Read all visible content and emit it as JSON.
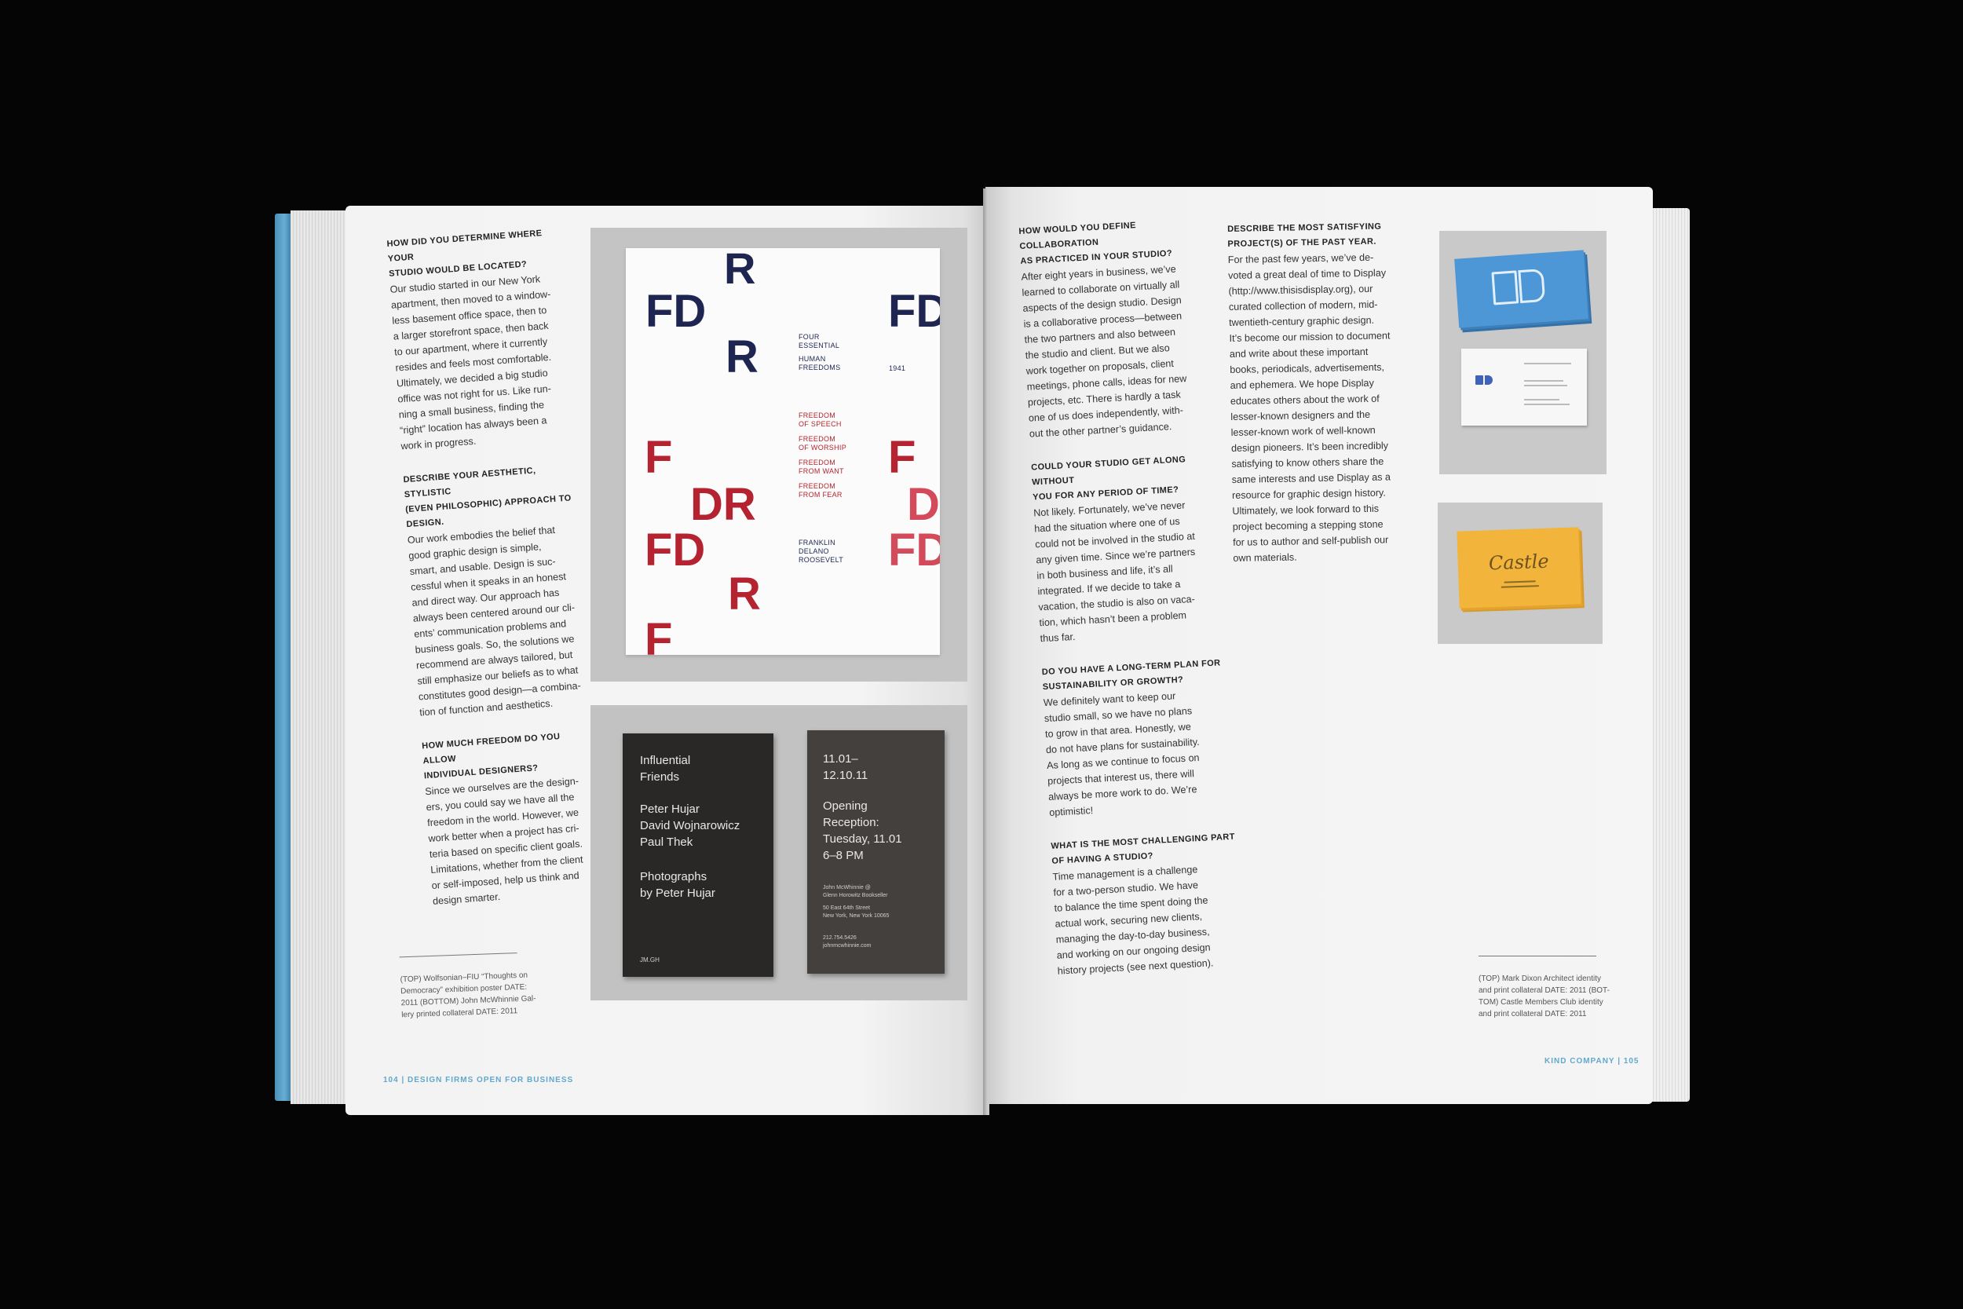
{
  "left_page": {
    "questions": [
      {
        "q": "How did you determine where your\nstudio would be located?",
        "a": "Our studio started in our New York\napartment, then moved to a window-\nless basement office space, then to\na larger storefront space, then back\nto our apartment, where it currently\nresides and feels most comfortable.\nUltimately, we decided a big studio\noffice was not right for us. Like run-\nning a small business, finding the\n“right” location has always been a\nwork in progress."
      },
      {
        "q": "Describe your aesthetic, stylistic\n(even philosophic) approach to\ndesign.",
        "a": "Our work embodies the belief that\ngood graphic design is simple,\nsmart, and usable. Design is suc-\ncessful when it speaks in an honest\nand direct way. Our approach has\nalways been centered around our cli-\nents’ communication problems and\nbusiness goals. So, the solutions we\nrecommend are always tailored, but\nstill emphasize our beliefs as to what\nconstitutes good design—a combina-\ntion of function and aesthetics."
      },
      {
        "q": "How much freedom do you allow\nindividual designers?",
        "a": "Since we ourselves are the design-\ners, you could say we have all the\nfreedom in the world. However, we\nwork better when a project has cri-\nteria based on specific client goals.\nLimitations, whether from the client\nor self-imposed, help us think and\ndesign smarter."
      }
    ],
    "caption": "(TOP) Wolfsonian–FIU “Thoughts on\nDemocracy” exhibition poster DATE:\n2011 (BOTTOM) John McWhinnie Gal-\nlery printed collateral DATE: 2011",
    "folio": "104  |  DESIGN FIRMS OPEN FOR BUSINESS"
  },
  "poster": {
    "letters": [
      "R",
      "FD",
      "FD",
      "R",
      "F",
      "F",
      "DR",
      "D",
      "FD",
      "FD",
      "R",
      "F"
    ],
    "text_four": "FOUR\nESSENTIAL",
    "text_human": "HUMAN\nFREEDOMS",
    "year": "1941",
    "freedom_speech": "FREEDOM\nOF SPEECH",
    "freedom_worship": "FREEDOM\nOF WORSHIP",
    "freedom_want": "FREEDOM\nFROM WANT",
    "freedom_fear": "FREEDOM\nFROM FEAR",
    "fdr_name": "FRANKLIN\nDELANO\nROOSEVELT"
  },
  "invites": {
    "card1_title": "Influential\nFriends",
    "card1_names": "Peter Hujar\nDavid Wojnarowicz\nPaul Thek",
    "card1_photos": "Photographs\nby Peter Hujar",
    "card1_logo": "JM.GH",
    "card2_dates": "11.01–\n12.10.11",
    "card2_opening": "Opening\nReception:\nTuesday, 11.01\n6–8 PM",
    "card2_gallery": "John McWhinnie @\nGlenn Horowitz Bookseller",
    "card2_address": "50 East 64th Street\nNew York, New York 10065",
    "card2_contact": "212.754.5426\njohnmcwhinnie.com"
  },
  "right_page": {
    "col1": [
      {
        "q": "How would you define collaboration\nas practiced in your studio?",
        "a": "After eight years in business, we’ve\nlearned to collaborate on virtually all\naspects of the design studio. Design\nis a collaborative process—between\nthe two partners and also between\nthe studio and client. But we also\nwork together on proposals, client\nmeetings, phone calls, ideas for new\nprojects, etc. There is hardly a task\none of us does independently, with-\nout the other partner’s guidance."
      },
      {
        "q": "Could your studio get along without\nyou for any period of time?",
        "a": "Not likely. Fortunately, we’ve never\nhad the situation where one of us\ncould not be involved in the studio at\nany given time. Since we’re partners\nin both business and life, it’s all\nintegrated. If we decide to take a\nvacation, the studio is also on vaca-\ntion, which hasn’t been a problem\nthus far."
      },
      {
        "q": "Do you have a long-term plan for\nsustainability or growth?",
        "a": "We definitely want to keep our\nstudio small, so we have no plans\nto grow in that area. Honestly, we\ndo not have plans for sustainability.\nAs long as we continue to focus on\nprojects that interest us, there will\nalways be more work to do. We’re\noptimistic!"
      },
      {
        "q": "What is the most challenging part\nof having a studio?",
        "a": "Time management is a challenge\nfor a two-person studio. We have\nto balance the time spent doing the\nactual work, securing new clients,\nmanaging the day-to-day business,\nand working on our ongoing design\nhistory projects (see next question)."
      }
    ],
    "col2": {
      "q": "Describe the most satisfying\nproject(s) of the past year.",
      "a": "For the past few years, we’ve de-\nvoted a great deal of time to Display\n(http://www.thisisdisplay.org), our\ncurated collection of modern, mid-\ntwentieth-century graphic design.\nIt’s become our mission to document\nand write about these important\nbooks, periodicals, advertisements,\nand ephemera. We hope Display\neducates others about the work of\nlesser-known designers and the\nlesser-known work of well-known\ndesign pioneers. It’s been incredibly\nsatisfying to know others share the\nsame interests and use Display as a\nresource for graphic design history.\nUltimately, we look forward to this\nproject becoming a stepping stone\nfor us to author and self-publish our\nown materials."
    },
    "caption": "(TOP) Mark Dixon Architect identity\nand print collateral DATE: 2011 (BOT-\nTOM) Castle Members Club identity\nand print collateral DATE: 2011",
    "folio": "KIND COMPANY  |  105",
    "castle_logo": "Castle"
  },
  "colors": {
    "background": "#050505",
    "page": "#f4f4f4",
    "cover_blue": "#5aa3cc",
    "poster_navy": "#1e2550",
    "poster_red": "#b4232f",
    "card_blue": "#4d97d6",
    "card_yellow": "#f2b43a",
    "folio_blue": "#62a8cc"
  }
}
